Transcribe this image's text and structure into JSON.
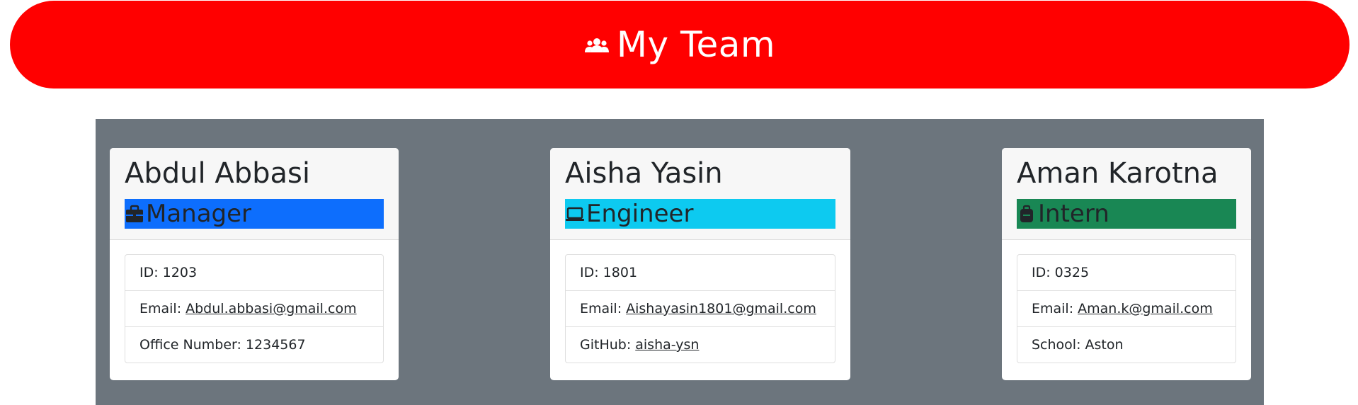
{
  "header": {
    "title": "My Team",
    "icon": "users-icon",
    "color": "#ff0000"
  },
  "employees": [
    {
      "name": "Abdul Abbasi",
      "role": "Manager",
      "role_icon": "briefcase-icon",
      "role_color": "#0d6efd",
      "id_label": "ID: 1203",
      "email_label": "Email:",
      "email": "Abdul.abbasi@gmail.com",
      "extra_label": "Office Number: 1234567",
      "extra_link": ""
    },
    {
      "name": "Aisha Yasin",
      "role": "Engineer",
      "role_icon": "laptop-icon",
      "role_color": "#0dcaf0",
      "id_label": "ID: 1801",
      "email_label": "Email:",
      "email": "Aishayasin1801@gmail.com",
      "extra_label": "GitHub:",
      "extra_link": "aisha-ysn"
    },
    {
      "name": "Aman Karotna",
      "role": "Intern",
      "role_icon": "backpack-icon",
      "role_color": "#198754",
      "id_label": "ID: 0325",
      "email_label": "Email:",
      "email": "Aman.k@gmail.com",
      "extra_label": "School: Aston",
      "extra_link": ""
    }
  ]
}
